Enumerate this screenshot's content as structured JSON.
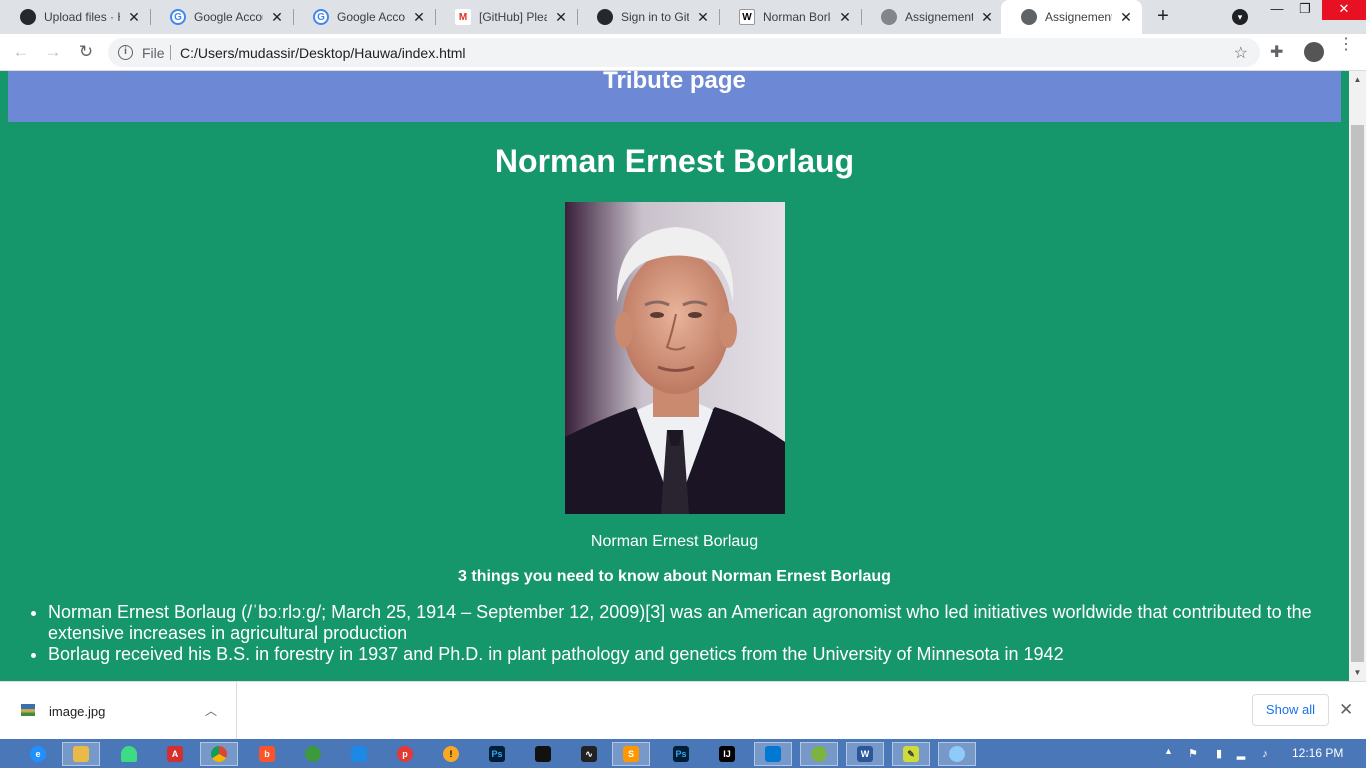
{
  "browser": {
    "tabs": [
      {
        "label": "Upload files · H",
        "icon": "github-icon",
        "active": false
      },
      {
        "label": "Google Accou",
        "icon": "google-icon",
        "active": false
      },
      {
        "label": "Google Accou",
        "icon": "google-icon",
        "active": false
      },
      {
        "label": "[GitHub] Pleas",
        "icon": "gmail-icon",
        "active": false
      },
      {
        "label": "Sign in to GitH",
        "icon": "github-icon",
        "active": false
      },
      {
        "label": "Norman Borla",
        "icon": "wikipedia-icon",
        "active": false
      },
      {
        "label": "Assignement c",
        "icon": "globe-icon",
        "active": false
      },
      {
        "label": "Assignement c",
        "icon": "globe-icon",
        "active": true
      }
    ],
    "new_tab_glyph": "+",
    "omnibox": {
      "scheme": "File",
      "url": "C:/Users/mudassir/Desktop/Hauwa/index.html"
    }
  },
  "page": {
    "header_title": "Tribute page",
    "title": "Norman Ernest Borlaug",
    "image_caption": "Norman Ernest Borlaug",
    "subtitle": "3 things you need to know about Norman Ernest Borlaug",
    "facts": [
      "Norman Ernest Borlaug (/ˈbɔːrlɔːɡ/; March 25, 1914 – September 12, 2009)[3] was an American agronomist who led initiatives worldwide that contributed to the extensive increases in agricultural production",
      "Borlaug received his B.S. in forestry in 1937 and Ph.D. in plant pathology and genetics from the University of Minnesota in 1942"
    ]
  },
  "downloads": {
    "file_name": "image.jpg",
    "show_all_label": "Show all"
  },
  "taskbar": {
    "clock": "12:16 PM"
  },
  "colors": {
    "page_background": "#16976b",
    "header_background": "#6d88d5",
    "taskbar": "#4a77b8"
  }
}
